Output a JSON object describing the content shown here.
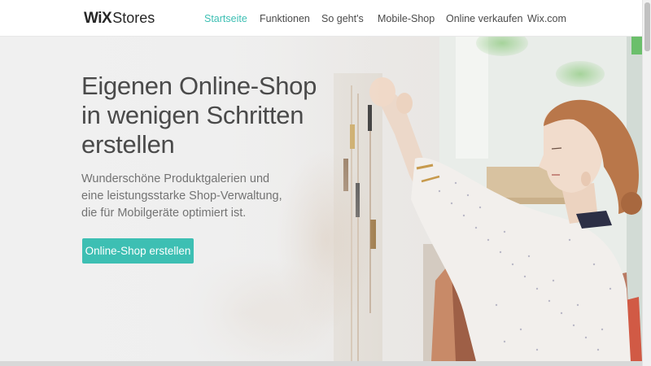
{
  "brand": {
    "logo_wix": "WiX",
    "logo_stores": "Stores"
  },
  "nav": {
    "items": [
      {
        "label": "Startseite",
        "active": true
      },
      {
        "label": "Funktionen",
        "active": false
      },
      {
        "label": "So geht's",
        "active": false
      },
      {
        "label": "Mobile-Shop",
        "active": false
      },
      {
        "label": "Online verkaufen",
        "active": false
      },
      {
        "label": "Wix.com",
        "active": false
      }
    ]
  },
  "hero": {
    "headline": [
      "Eigenen Online-Shop",
      "in wenigen Schritten",
      "erstellen"
    ],
    "subtext": [
      "Wunderschöne Produktgalerien und",
      "eine leistungsstarke Shop-Verwaltung,",
      "die für Mobilgeräte optimiert ist."
    ],
    "cta_label": "Online-Shop erstellen"
  },
  "colors": {
    "accent": "#3dbfb3",
    "text_dark": "#4a4a4a",
    "text_muted": "#737373",
    "header_bg": "#ffffff"
  },
  "icons": {
    "logo": "wix-stores-logo"
  }
}
